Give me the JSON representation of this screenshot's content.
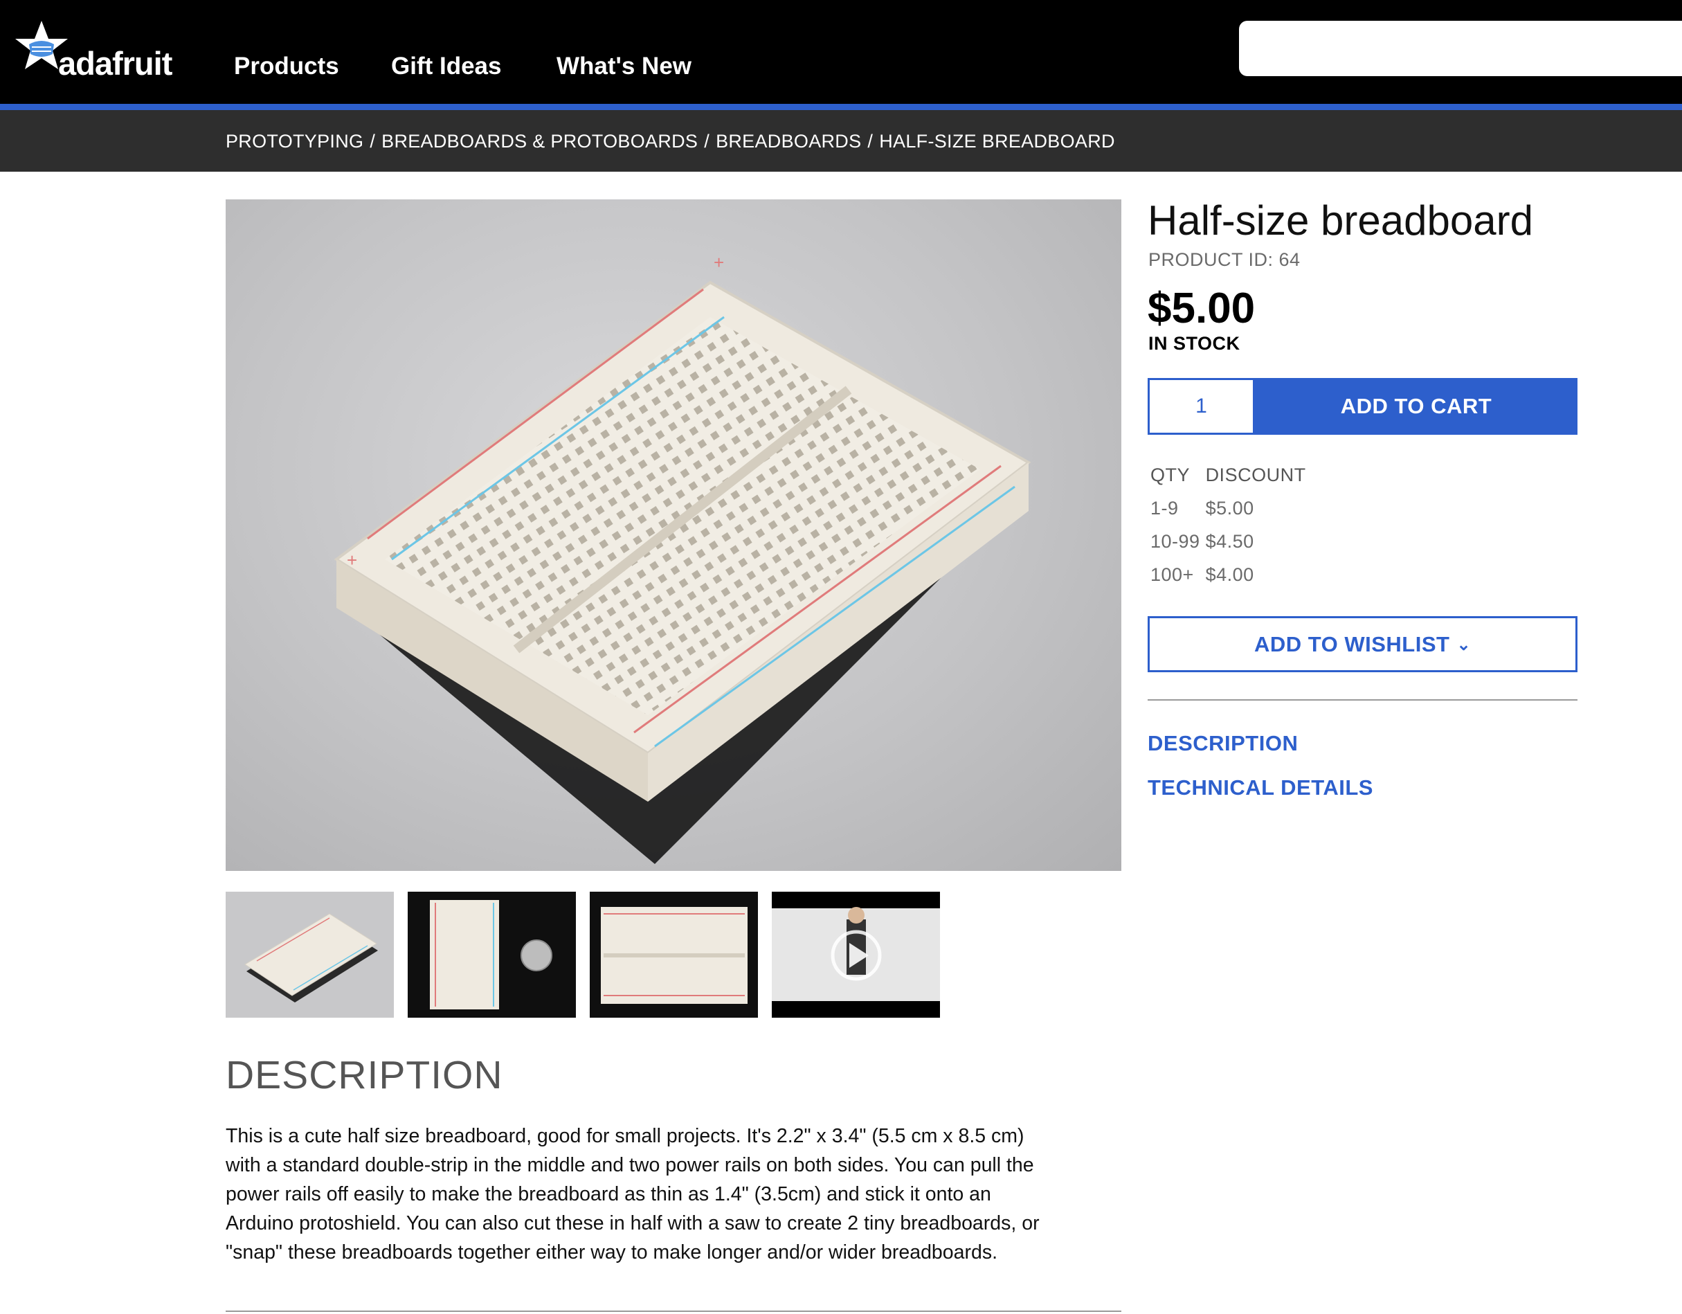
{
  "brand": {
    "logo_text": "adafruit"
  },
  "nav": {
    "items": [
      {
        "label": "Products"
      },
      {
        "label": "Gift Ideas"
      },
      {
        "label": "What's New"
      }
    ],
    "search": {
      "placeholder": ""
    }
  },
  "breadcrumb": [
    {
      "label": "PROTOTYPING"
    },
    {
      "label": "BREADBOARDS & PROTOBOARDS"
    },
    {
      "label": "BREADBOARDS"
    },
    {
      "label": "HALF-SIZE BREADBOARD"
    }
  ],
  "breadcrumb_separator": "/",
  "product": {
    "title": "Half-size breadboard",
    "id_text": "PRODUCT ID: 64",
    "price": "$5.00",
    "stock": "IN STOCK",
    "quantity": "1",
    "add_to_cart_label": "ADD TO CART",
    "wishlist_label": "ADD TO WISHLIST",
    "discount_table": {
      "headers": [
        "QTY",
        "DISCOUNT"
      ],
      "rows": [
        [
          "1-9",
          "$5.00"
        ],
        [
          "10-99",
          "$4.50"
        ],
        [
          "100+",
          "$4.00"
        ]
      ]
    },
    "section_links": [
      "DESCRIPTION",
      "TECHNICAL DETAILS"
    ]
  },
  "gallery": {
    "thumbnails": [
      "breadboard-angle",
      "breadboard-with-coin",
      "breadboard-top",
      "video"
    ]
  },
  "description": {
    "heading": "DESCRIPTION",
    "lines": [
      "This is a cute half size breadboard, good for small projects. It's 2.2\" x 3.4\" (5.5 cm x 8.5 cm)",
      "with a standard double-strip in the middle and two power rails on both sides. You can pull the",
      "power rails off easily to make the breadboard as thin as 1.4\" (3.5cm) and stick it onto an",
      "Arduino protoshield. You can also cut these in half with a saw to create 2 tiny breadboards, or",
      "\"snap\" these breadboards together either way to make longer and/or wider breadboards."
    ]
  },
  "colors": {
    "brand_blue": "#2d5fcc",
    "nav_bg": "#000000",
    "breadcrumb_bg": "#2e2e2e"
  }
}
